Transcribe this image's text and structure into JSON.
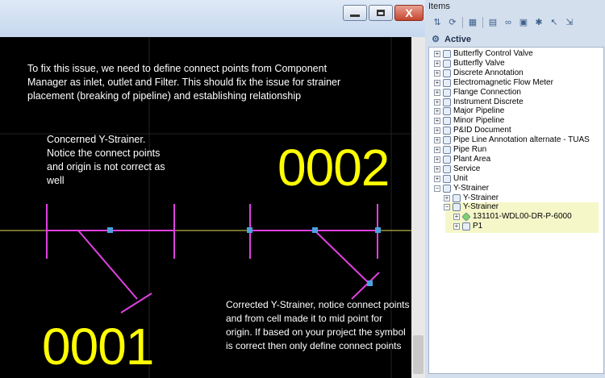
{
  "window_controls": {
    "minimize": "—",
    "maximize": "□",
    "close": "X"
  },
  "cad": {
    "intro_note": "To fix this issue, we need to define connect points from Component Manager as inlet, outlet and Filter. This should fix the issue for strainer placement (breaking of pipeline) and establishing relationship",
    "concerned_note": "Concerned Y-Strainer. Notice the connect points and origin is not correct as well",
    "corrected_note": "Corrected Y-Strainer, notice connect points and from cell made it to mid point for origin. If based on your project the symbol is correct then only define connect points",
    "label_0001": "0001",
    "label_0002": "0002",
    "colors": {
      "background": "#000000",
      "pipeline": "#e3e05a",
      "symbol": "#e040e0",
      "connect_point": "#4aa3df",
      "label": "#ffff00"
    }
  },
  "items_panel": {
    "header": "Items",
    "toolbar_icons": [
      "sort-icon",
      "refresh-icon",
      "grid-icon",
      "clipboard-icon",
      "link-icon",
      "tag-icon",
      "filter-icon",
      "cursor-icon",
      "settings-icon"
    ],
    "active_label": "Active",
    "tree": [
      {
        "label": "Butterfly Control Valve",
        "level": 0,
        "expander": "+",
        "icon": "valve-icon"
      },
      {
        "label": "Butterfly Valve",
        "level": 0,
        "expander": "+",
        "icon": "valve-icon"
      },
      {
        "label": "Discrete Annotation",
        "level": 0,
        "expander": "+",
        "icon": "annotation-icon"
      },
      {
        "label": "Electromagnetic Flow Meter",
        "level": 0,
        "expander": "+",
        "icon": "meter-icon"
      },
      {
        "label": "Flange Connection",
        "level": 0,
        "expander": "+",
        "icon": "flange-icon"
      },
      {
        "label": "Instrument Discrete",
        "level": 0,
        "expander": "+",
        "icon": "instrument-icon"
      },
      {
        "label": "Major Pipeline",
        "level": 0,
        "expander": "+",
        "icon": "pipeline-icon"
      },
      {
        "label": "Minor Pipeline",
        "level": 0,
        "expander": "+",
        "icon": "pipeline-icon"
      },
      {
        "label": "P&ID Document",
        "level": 0,
        "expander": "+",
        "icon": "document-icon"
      },
      {
        "label": "Pipe Line Annotation alternate - TUAS",
        "level": 0,
        "expander": "+",
        "icon": "annotation-icon"
      },
      {
        "label": "Pipe Run",
        "level": 0,
        "expander": "+",
        "icon": "pipe-run-icon"
      },
      {
        "label": "Plant Area",
        "level": 0,
        "expander": "+",
        "icon": "area-icon"
      },
      {
        "label": "Service",
        "level": 0,
        "expander": "+",
        "icon": "service-icon"
      },
      {
        "label": "Unit",
        "level": 0,
        "expander": "+",
        "icon": "unit-icon"
      },
      {
        "label": "Y-Strainer",
        "level": 0,
        "expander": "−",
        "icon": "strainer-icon"
      },
      {
        "label": "Y-Strainer",
        "level": 1,
        "expander": "+",
        "icon": "strainer-icon"
      },
      {
        "label": "Y-Strainer",
        "level": 1,
        "expander": "−",
        "icon": "strainer-icon"
      },
      {
        "label": "131101-WDL00-DR-P-6000",
        "level": 2,
        "expander": "+",
        "icon": "diamond-icon"
      },
      {
        "label": "P1",
        "level": 2,
        "expander": "+",
        "icon": "pipe-icon"
      }
    ]
  }
}
